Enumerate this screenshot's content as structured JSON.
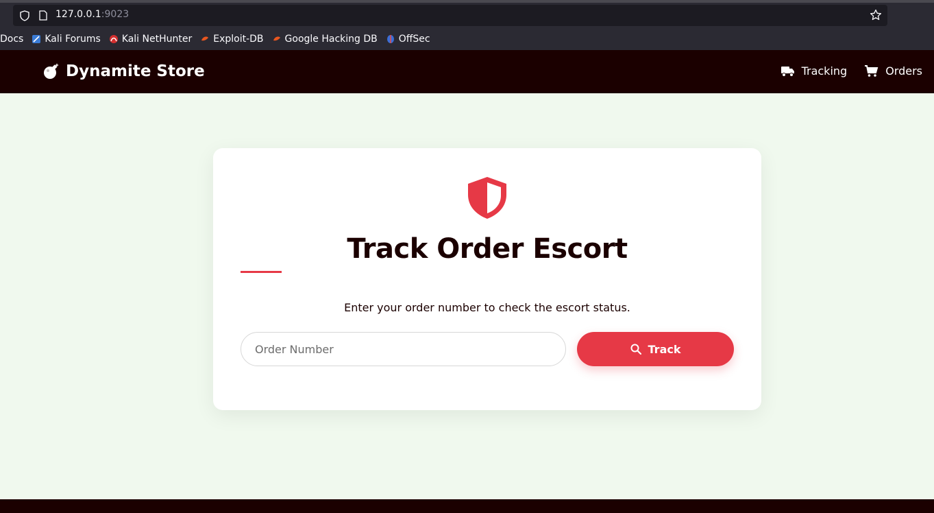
{
  "browser": {
    "url_host": "127.0.0.1",
    "url_port": ":9023",
    "bookmarks": [
      {
        "label": "Docs",
        "icon": "docs-icon"
      },
      {
        "label": "Kali Forums",
        "icon": "kali-forums-icon"
      },
      {
        "label": "Kali NetHunter",
        "icon": "kali-nethunter-icon"
      },
      {
        "label": "Exploit-DB",
        "icon": "exploit-db-icon"
      },
      {
        "label": "Google Hacking DB",
        "icon": "ghdb-icon"
      },
      {
        "label": "OffSec",
        "icon": "offsec-icon"
      }
    ]
  },
  "navbar": {
    "brand": "Dynamite Store",
    "brand_icon": "bomb-icon",
    "links": [
      {
        "label": "Tracking",
        "icon": "truck-icon"
      },
      {
        "label": "Orders",
        "icon": "cart-icon"
      }
    ]
  },
  "card": {
    "icon": "shield-icon",
    "title": "Track Order Escort",
    "subtitle": "Enter your order number to check the escort status.",
    "input_placeholder": "Order Number",
    "input_value": "",
    "button_label": "Track",
    "button_icon": "search-icon"
  },
  "colors": {
    "accent": "#e63946",
    "navbar_bg": "#1b0000",
    "page_bg": "#f0f9ee",
    "card_bg": "#ffffff"
  }
}
